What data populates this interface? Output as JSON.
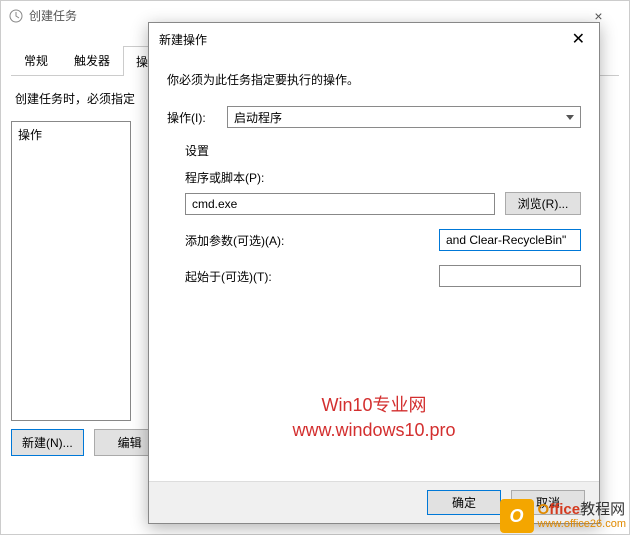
{
  "parent": {
    "title": "创建任务",
    "close_glyph": "×",
    "tabs": [
      "常规",
      "触发器",
      "操作"
    ],
    "instruction": "创建任务时，必须指定",
    "list_header": "操作",
    "buttons": {
      "new": "新建(N)...",
      "edit": "编辑"
    }
  },
  "modal": {
    "title": "新建操作",
    "close_glyph": "✕",
    "instruction": "你必须为此任务指定要执行的操作。",
    "action_label": "操作(I):",
    "action_value": "启动程序",
    "settings_label": "设置",
    "program_label": "程序或脚本(P):",
    "program_value": "cmd.exe",
    "browse_label": "浏览(R)...",
    "args_label": "添加参数(可选)(A):",
    "args_value": "and Clear-RecycleBin\"",
    "startin_label": "起始于(可选)(T):",
    "startin_value": "",
    "ok_label": "确定",
    "cancel_label": "取消"
  },
  "watermark": {
    "line1": "Win10专业网",
    "line2": "www.windows10.pro"
  },
  "badge": {
    "icon_letter": "O",
    "main_o": "O",
    "main_ffice": "ffice",
    "main_rest": "教程网",
    "sub": "www.office26.com"
  }
}
